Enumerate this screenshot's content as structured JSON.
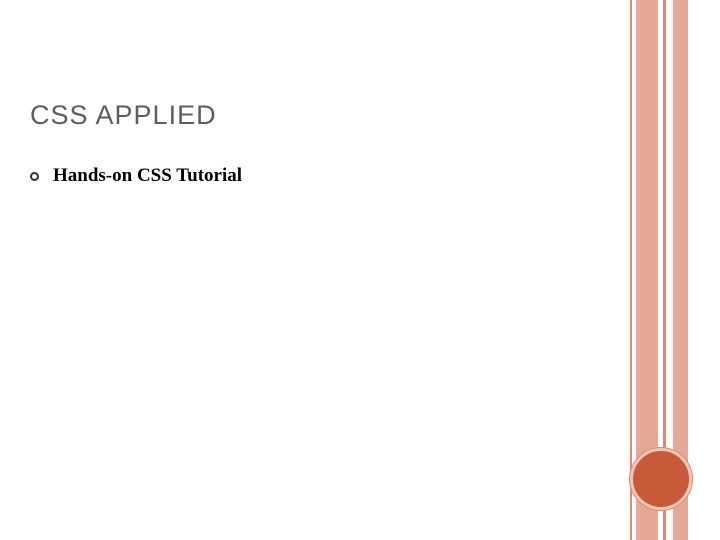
{
  "title": "CSS APPLIED",
  "bullets": [
    {
      "text": "Hands-on CSS Tutorial"
    }
  ]
}
